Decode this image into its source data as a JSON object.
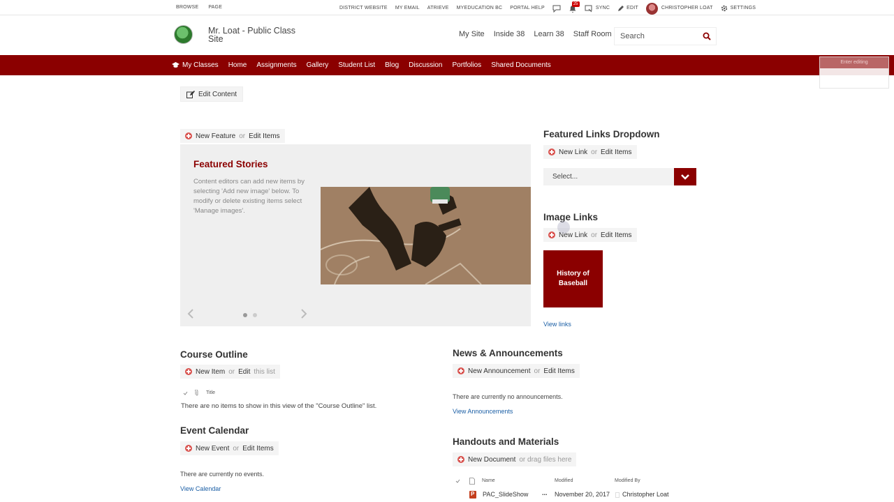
{
  "topbar": {
    "left": [
      "BROWSE",
      "PAGE"
    ],
    "links": [
      "DISTRICT WEBSITE",
      "MY EMAIL",
      "ATRIEVE",
      "MYEDUCATION BC",
      "PORTAL HELP"
    ],
    "notification_count": "25",
    "sync": "SYNC",
    "edit": "EDIT",
    "user": "CHRISTOPHER LOAT",
    "settings": "SETTINGS"
  },
  "header": {
    "site_title": "Mr. Loat - Public Class Site",
    "nav": [
      "My Site",
      "Inside 38",
      "Learn 38",
      "Staff Room"
    ],
    "search_placeholder": "Search"
  },
  "rednav": {
    "my_classes": "My Classes",
    "items": [
      "Home",
      "Assignments",
      "Gallery",
      "Student List",
      "Blog",
      "Discussion",
      "Portfolios",
      "Shared Documents"
    ],
    "ghost_label": "Enter editing"
  },
  "edit_content": "Edit Content",
  "actions": {
    "or": "or",
    "new_feature": "New Feature",
    "edit_items": "Edit Items",
    "new_link": "New Link",
    "new_item": "New Item",
    "edit": "Edit",
    "this_list": "this list",
    "new_announcement": "New Announcement",
    "new_event": "New Event",
    "new_document": "New Document",
    "drag_files": "or drag files here"
  },
  "featured": {
    "title": "Featured Stories",
    "description": "Content editors can add new items by selecting 'Add new image' below. To modify or delete existing items select 'Manage images'."
  },
  "featured_links": {
    "title": "Featured Links Dropdown",
    "select_value": "Select..."
  },
  "image_links": {
    "title": "Image Links",
    "tile": "History of Baseball",
    "view": "View links"
  },
  "course_outline": {
    "title": "Course Outline",
    "col_title": "Title",
    "empty": "There are no items to show in this view of the \"Course Outline\" list."
  },
  "event_calendar": {
    "title": "Event Calendar",
    "empty": "There are currently no events.",
    "view": "View Calendar"
  },
  "news": {
    "title": "News & Announcements",
    "empty": "There are currently no announcements.",
    "view": "View Announcements"
  },
  "handouts": {
    "title": "Handouts and Materials",
    "columns": [
      "Name",
      "Modified",
      "Modified By"
    ],
    "rows": [
      {
        "name": "PAC_SlideShow",
        "menu": "...",
        "modified": "November 20, 2017",
        "modified_by": "Christopher Loat"
      }
    ]
  }
}
